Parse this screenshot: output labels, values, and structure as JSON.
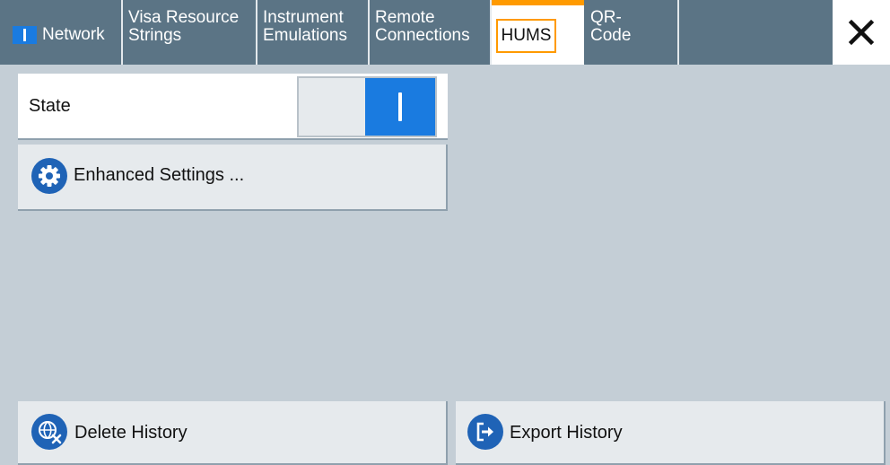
{
  "tabs": [
    {
      "id": "network",
      "label": "Network"
    },
    {
      "id": "visa",
      "line1": "Visa Resource",
      "line2": "Strings"
    },
    {
      "id": "instrument",
      "line1": "Instrument",
      "line2": "Emulations"
    },
    {
      "id": "remote",
      "line1": "Remote",
      "line2": "Connections"
    },
    {
      "id": "hums",
      "label": "HUMS",
      "active": true
    },
    {
      "id": "qr",
      "line1": "QR-",
      "line2": "Code"
    }
  ],
  "state": {
    "label": "State",
    "value": "on"
  },
  "buttons": {
    "enhanced": "Enhanced Settings ...",
    "delete": "Delete History",
    "export": "Export History"
  },
  "colors": {
    "tab_bar": "#5b7485",
    "active_accent": "#ff9a00",
    "toggle_on": "#1a7be0",
    "icon_bg": "#1f63b6",
    "background": "#c4ced6"
  },
  "icons": {
    "network_indicator": "toggle-on-indicator",
    "close": "close-icon",
    "enhanced": "gear-icon",
    "delete": "globe-delete-icon",
    "export": "export-icon"
  }
}
